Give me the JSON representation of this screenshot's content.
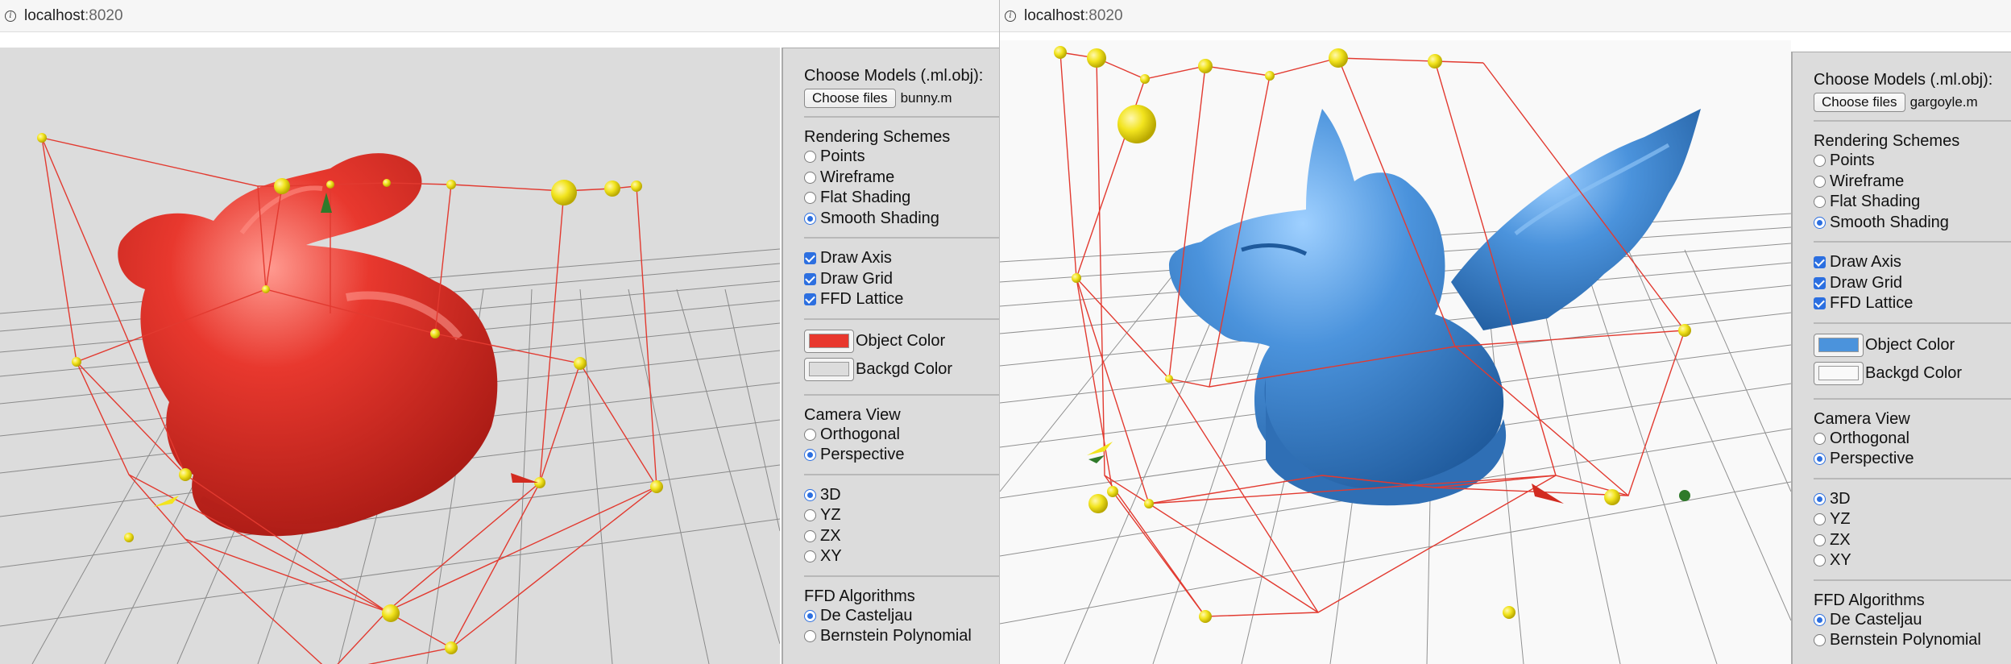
{
  "windows": [
    {
      "url_host": "localhost",
      "url_port": ":8020",
      "file_button": "Choose files",
      "file_name": "bunny.m",
      "object_color": "#e8382e",
      "background_color": "#dcdcdc",
      "model": "bunny"
    },
    {
      "url_host": "localhost",
      "url_port": ":8020",
      "file_button": "Choose files",
      "file_name": "gargoyle.m",
      "object_color": "#4b93dc",
      "background_color": "#f9f9f9",
      "model": "gargoyle"
    }
  ],
  "panel": {
    "choose_models": "Choose Models (.ml.obj):",
    "rendering_title": "Rendering Schemes",
    "rendering_options": [
      "Points",
      "Wireframe",
      "Flat Shading",
      "Smooth Shading"
    ],
    "rendering_selected": "Smooth Shading",
    "draw_axis": "Draw Axis",
    "draw_grid": "Draw Grid",
    "ffd_lattice": "FFD Lattice",
    "object_color_label": "Object Color",
    "background_color_label": "Backgd Color",
    "camera_title": "Camera View",
    "camera_options": [
      "Orthogonal",
      "Perspective"
    ],
    "camera_selected": "Perspective",
    "view_options": [
      "3D",
      "YZ",
      "ZX",
      "XY"
    ],
    "view_selected": "3D",
    "ffd_title": "FFD Algorithms",
    "ffd_options": [
      "De Casteljau",
      "Bernstein Polynomial"
    ],
    "ffd_selected": "De Casteljau"
  },
  "icons": {
    "info": "info-icon",
    "lattice_point": "control-point-icon"
  }
}
